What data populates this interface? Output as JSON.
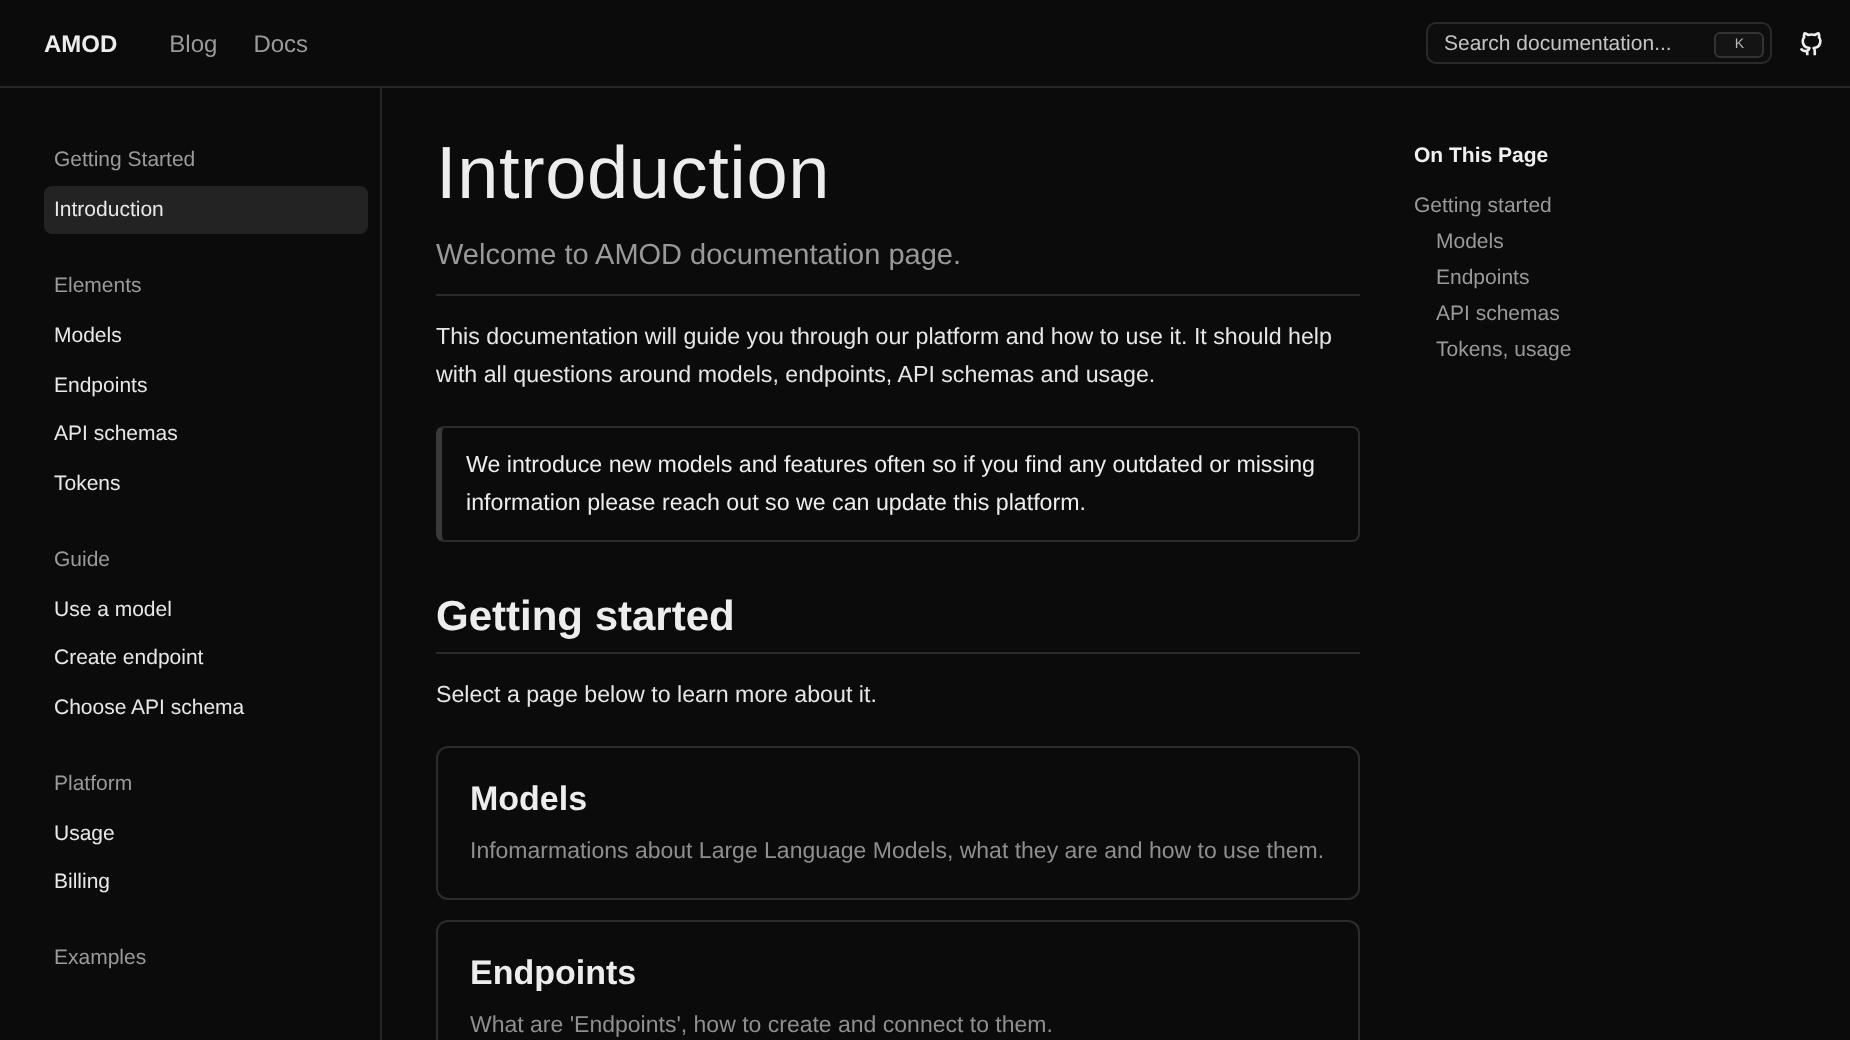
{
  "header": {
    "logo": "AMOD",
    "nav": [
      {
        "label": "Blog"
      },
      {
        "label": "Docs"
      }
    ],
    "search": {
      "placeholder": "Search documentation...",
      "shortcut": "K"
    }
  },
  "sidebar": {
    "sections": [
      {
        "title": "Getting Started",
        "items": [
          {
            "label": "Introduction",
            "selected": true
          }
        ]
      },
      {
        "title": "Elements",
        "items": [
          {
            "label": "Models",
            "selected": false
          },
          {
            "label": "Endpoints",
            "selected": false
          },
          {
            "label": "API schemas",
            "selected": false
          },
          {
            "label": "Tokens",
            "selected": false
          }
        ]
      },
      {
        "title": "Guide",
        "items": [
          {
            "label": "Use a model",
            "selected": false
          },
          {
            "label": "Create endpoint",
            "selected": false
          },
          {
            "label": "Choose API schema",
            "selected": false
          }
        ]
      },
      {
        "title": "Platform",
        "items": [
          {
            "label": "Usage",
            "selected": false
          },
          {
            "label": "Billing",
            "selected": false
          }
        ]
      },
      {
        "title": "Examples"
      }
    ]
  },
  "main": {
    "title": "Introduction",
    "subtitle": "Welcome to AMOD documentation page.",
    "intro": "This documentation will guide you through our platform and how to use it. It should help with all questions around models, endpoints, API schemas and usage.",
    "callout": "We introduce new models and features often so if you find any outdated or missing information please reach out so we can update this platform.",
    "section_title": "Getting started",
    "section_text": "Select a page below to learn more about it.",
    "cards": [
      {
        "title": "Models",
        "description": "Infomarmations about Large Language Models, what they are and how to use them."
      },
      {
        "title": "Endpoints",
        "description": "What are 'Endpoints', how to create and connect to them."
      }
    ]
  },
  "toc": {
    "title": "On This Page",
    "items": [
      {
        "label": "Getting started",
        "children": [
          {
            "label": "Models"
          },
          {
            "label": "Endpoints"
          },
          {
            "label": "API schemas"
          },
          {
            "label": "Tokens, usage"
          }
        ]
      }
    ]
  }
}
